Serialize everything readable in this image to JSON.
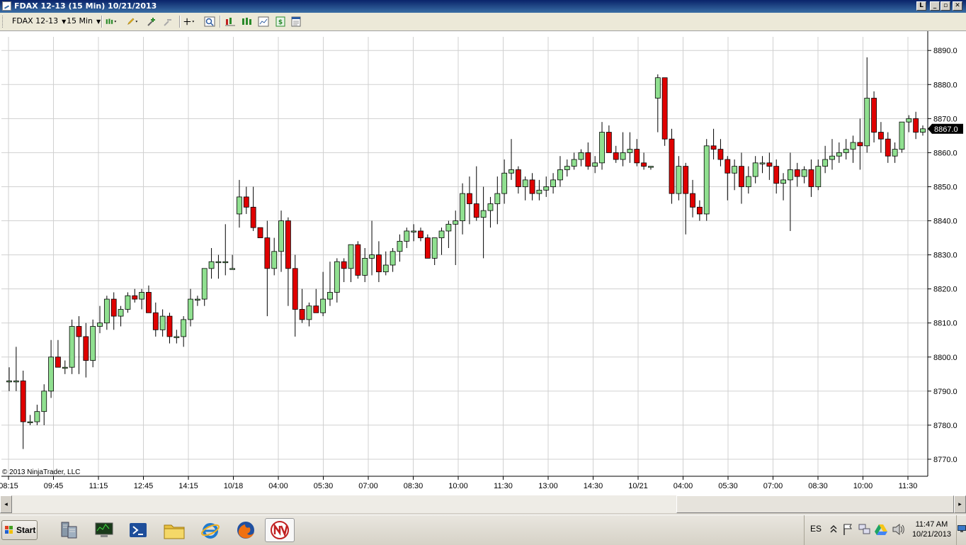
{
  "window": {
    "title": "FDAX 12-13 (15 Min)  10/21/2013"
  },
  "toolbar": {
    "instrument": "FDAX 12-13",
    "interval": "15 Min"
  },
  "chart_data": {
    "type": "candlestick",
    "copyright": "© 2013 NinjaTrader, LLC",
    "ylim": [
      8765,
      8894
    ],
    "y_ticks": [
      8770,
      8780,
      8790,
      8800,
      8810,
      8820,
      8830,
      8840,
      8850,
      8860,
      8870,
      8880,
      8890
    ],
    "last_price_label": "8867.0",
    "x_ticks": [
      "08:15",
      "09:45",
      "11:15",
      "12:45",
      "14:15",
      "10/18",
      "04:00",
      "05:30",
      "07:00",
      "08:30",
      "10:00",
      "11:30",
      "13:00",
      "14:30",
      "10/21",
      "04:00",
      "05:30",
      "07:00",
      "08:30",
      "10:00",
      "11:30"
    ],
    "grid": true,
    "up_color": "#90e090",
    "down_color": "#e00000",
    "candles": [
      [
        8793,
        8797,
        8790,
        8793
      ],
      [
        8793,
        8803,
        8790,
        8793
      ],
      [
        8793,
        8796,
        8773,
        8781
      ],
      [
        8781,
        8783,
        8780,
        8781
      ],
      [
        8781,
        8786,
        8780,
        8784
      ],
      [
        8784,
        8792,
        8780,
        8790
      ],
      [
        8790,
        8805,
        8788,
        8800
      ],
      [
        8800,
        8805,
        8797,
        8797
      ],
      [
        8797,
        8799,
        8795,
        8797
      ],
      [
        8797,
        8811,
        8795,
        8809
      ],
      [
        8809,
        8812,
        8795,
        8806
      ],
      [
        8806,
        8810,
        8794,
        8799
      ],
      [
        8799,
        8811,
        8797,
        8809
      ],
      [
        8809,
        8815,
        8807,
        8810
      ],
      [
        8810,
        8818,
        8808,
        8817
      ],
      [
        8817,
        8819,
        8808,
        8812
      ],
      [
        8812,
        8815,
        8809,
        8814
      ],
      [
        8814,
        8819,
        8813,
        8818
      ],
      [
        8818,
        8820,
        8816,
        8817
      ],
      [
        8817,
        8820,
        8814,
        8819
      ],
      [
        8819,
        8821,
        8813,
        8813
      ],
      [
        8813,
        8816,
        8806,
        8808
      ],
      [
        8808,
        8814,
        8806,
        8812
      ],
      [
        8812,
        8813,
        8804,
        8806
      ],
      [
        8806,
        8808,
        8804,
        8806
      ],
      [
        8806,
        8812,
        8803,
        8811
      ],
      [
        8811,
        8820,
        8809,
        8817
      ],
      [
        8817,
        8818,
        8815,
        8817
      ],
      [
        8817,
        8823,
        8815,
        8826
      ],
      [
        8826,
        8832,
        8823,
        8828
      ],
      [
        8828,
        8830,
        8823,
        8828
      ],
      [
        8828,
        8839,
        8824,
        8828
      ],
      [
        8826,
        8830,
        8826,
        8826
      ],
      [
        8842,
        8852,
        8838,
        8847
      ],
      [
        8847,
        8850,
        8842,
        8844
      ],
      [
        8844,
        8850,
        8837,
        8838
      ],
      [
        8838,
        8838,
        8835,
        8835
      ],
      [
        8835,
        8840,
        8812,
        8826
      ],
      [
        8826,
        8835,
        8824,
        8831
      ],
      [
        8831,
        8843,
        8825,
        8840
      ],
      [
        8840,
        8841,
        8815,
        8826
      ],
      [
        8826,
        8830,
        8806,
        8814
      ],
      [
        8814,
        8820,
        8810,
        8811
      ],
      [
        8811,
        8816,
        8809,
        8815
      ],
      [
        8815,
        8820,
        8813,
        8813
      ],
      [
        8813,
        8825,
        8812,
        8817
      ],
      [
        8817,
        8828,
        8815,
        8819
      ],
      [
        8819,
        8829,
        8816,
        8828
      ],
      [
        8828,
        8829,
        8822,
        8826
      ],
      [
        8826,
        8832,
        8822,
        8833
      ],
      [
        8833,
        8834,
        8823,
        8824
      ],
      [
        8824,
        8832,
        8822,
        8829
      ],
      [
        8829,
        8840,
        8824,
        8830
      ],
      [
        8830,
        8834,
        8822,
        8825
      ],
      [
        8825,
        8831,
        8824,
        8827
      ],
      [
        8827,
        8832,
        8825,
        8831
      ],
      [
        8831,
        8836,
        8828,
        8834
      ],
      [
        8834,
        8838,
        8832,
        8837
      ],
      [
        8837,
        8839,
        8834,
        8837
      ],
      [
        8837,
        8838,
        8834,
        8835
      ],
      [
        8835,
        8836,
        8829,
        8829
      ],
      [
        8829,
        8835,
        8827,
        8835
      ],
      [
        8835,
        8838,
        8830,
        8837
      ],
      [
        8837,
        8840,
        8832,
        8839
      ],
      [
        8839,
        8843,
        8827,
        8840
      ],
      [
        8840,
        8851,
        8836,
        8848
      ],
      [
        8848,
        8853,
        8839,
        8845
      ],
      [
        8845,
        8856,
        8840,
        8841
      ],
      [
        8841,
        8850,
        8829,
        8843
      ],
      [
        8843,
        8847,
        8838,
        8845
      ],
      [
        8845,
        8853,
        8839,
        8848
      ],
      [
        8848,
        8858,
        8845,
        8854
      ],
      [
        8854,
        8864,
        8852,
        8855
      ],
      [
        8855,
        8856,
        8848,
        8850
      ],
      [
        8850,
        8853,
        8846,
        8852
      ],
      [
        8852,
        8854,
        8846,
        8848
      ],
      [
        8848,
        8852,
        8846,
        8849
      ],
      [
        8849,
        8853,
        8847,
        8850
      ],
      [
        8850,
        8854,
        8848,
        8852
      ],
      [
        8852,
        8859,
        8850,
        8855
      ],
      [
        8855,
        8858,
        8853,
        8856
      ],
      [
        8856,
        8860,
        8855,
        8858
      ],
      [
        8858,
        8861,
        8856,
        8860
      ],
      [
        8860,
        8863,
        8855,
        8856
      ],
      [
        8856,
        8859,
        8854,
        8857
      ],
      [
        8857,
        8869,
        8855,
        8866
      ],
      [
        8866,
        8868,
        8860,
        8860
      ],
      [
        8860,
        8862,
        8857,
        8858
      ],
      [
        8858,
        8866,
        8856,
        8860
      ],
      [
        8860,
        8866,
        8857,
        8861
      ],
      [
        8861,
        8864,
        8856,
        8857
      ],
      [
        8857,
        8860,
        8855,
        8856
      ],
      [
        8856,
        8856,
        8855,
        8856
      ],
      [
        8876,
        8883,
        8866,
        8882
      ],
      [
        8882,
        8882,
        8862,
        8864
      ],
      [
        8864,
        8867,
        8845,
        8848
      ],
      [
        8848,
        8859,
        8846,
        8856
      ],
      [
        8856,
        8857,
        8836,
        8848
      ],
      [
        8848,
        8852,
        8841,
        8844
      ],
      [
        8844,
        8846,
        8840,
        8842
      ],
      [
        8842,
        8864,
        8840,
        8862
      ],
      [
        8862,
        8867,
        8858,
        8861
      ],
      [
        8861,
        8864,
        8856,
        8858
      ],
      [
        8858,
        8859,
        8846,
        8854
      ],
      [
        8854,
        8858,
        8849,
        8856
      ],
      [
        8856,
        8860,
        8845,
        8850
      ],
      [
        8850,
        8856,
        8848,
        8853
      ],
      [
        8853,
        8859,
        8851,
        8857
      ],
      [
        8857,
        8859,
        8854,
        8857
      ],
      [
        8857,
        8860,
        8852,
        8856
      ],
      [
        8856,
        8858,
        8848,
        8851
      ],
      [
        8851,
        8854,
        8846,
        8852
      ],
      [
        8852,
        8860,
        8837,
        8855
      ],
      [
        8855,
        8857,
        8850,
        8853
      ],
      [
        8853,
        8856,
        8851,
        8855
      ],
      [
        8855,
        8858,
        8847,
        8850
      ],
      [
        8850,
        8858,
        8849,
        8856
      ],
      [
        8856,
        8862,
        8854,
        8858
      ],
      [
        8858,
        8864,
        8855,
        8859
      ],
      [
        8859,
        8863,
        8857,
        8860
      ],
      [
        8860,
        8864,
        8858,
        8861
      ],
      [
        8861,
        8865,
        8857,
        8863
      ],
      [
        8863,
        8870,
        8855,
        8862
      ],
      [
        8862,
        8888,
        8860,
        8876
      ],
      [
        8876,
        8878,
        8863,
        8866
      ],
      [
        8866,
        8869,
        8860,
        8864
      ],
      [
        8864,
        8866,
        8857,
        8859
      ],
      [
        8859,
        8863,
        8857,
        8861
      ],
      [
        8861,
        8868,
        8860,
        8869
      ],
      [
        8869,
        8871,
        8866,
        8870
      ],
      [
        8870,
        8872,
        8864,
        8866
      ],
      [
        8866,
        8868,
        8865,
        8867
      ]
    ]
  },
  "scrollbar": {
    "left_arrow": "◂",
    "right_arrow": "▸"
  },
  "taskbar": {
    "start_label": "Start",
    "language": "ES",
    "time": "11:47 AM",
    "date": "10/21/2013",
    "apps": [
      "server-manager-icon",
      "monitor-icon",
      "powershell-icon",
      "explorer-folder-icon",
      "internet-explorer-icon",
      "firefox-icon",
      "ninjatrader-icon"
    ]
  }
}
